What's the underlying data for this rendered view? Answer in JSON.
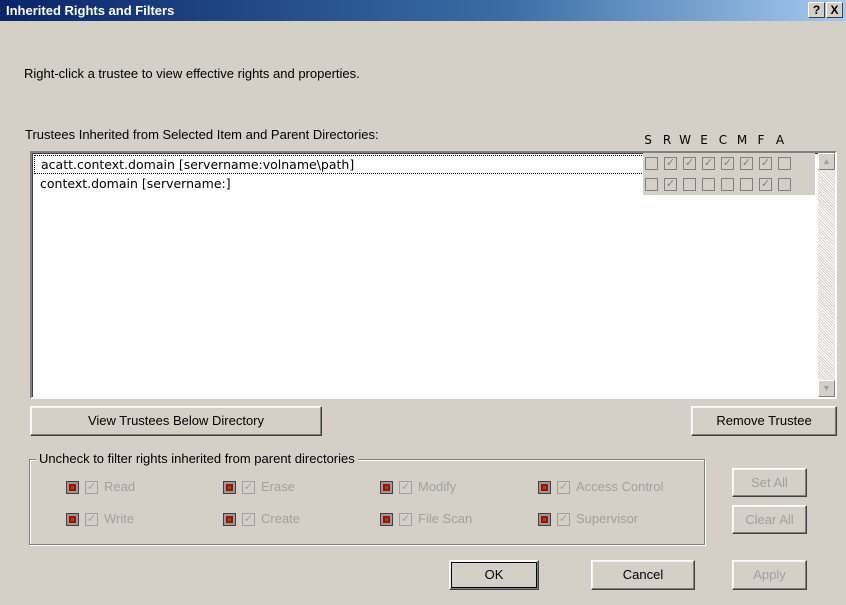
{
  "window": {
    "title": "Inherited Rights and Filters",
    "help_glyph": "?",
    "close_glyph": "X"
  },
  "instruction": "Right-click a trustee to view effective rights and properties.",
  "trustees_label": "Trustees Inherited from Selected Item and Parent Directories:",
  "rights_columns": [
    "S",
    "R",
    "W",
    "E",
    "C",
    "M",
    "F",
    "A"
  ],
  "trustees": [
    {
      "name": "acatt.context.domain [servername:volname\\path]",
      "rights": [
        false,
        true,
        true,
        true,
        true,
        true,
        true,
        false
      ]
    },
    {
      "name": "context.domain [servername:]",
      "rights": [
        false,
        true,
        false,
        false,
        false,
        false,
        true,
        false
      ]
    }
  ],
  "buttons": {
    "view_trustees": "View Trustees Below Directory",
    "remove_trustee": "Remove Trustee",
    "set_all": "Set All",
    "clear_all": "Clear All",
    "ok": "OK",
    "cancel": "Cancel",
    "apply": "Apply"
  },
  "filter_group": {
    "legend": "Uncheck to filter rights inherited from parent directories",
    "items": [
      {
        "label": "Read",
        "checked": true
      },
      {
        "label": "Erase",
        "checked": true
      },
      {
        "label": "Modify",
        "checked": true
      },
      {
        "label": "Access Control",
        "checked": true
      },
      {
        "label": "Write",
        "checked": true
      },
      {
        "label": "Create",
        "checked": true
      },
      {
        "label": "File Scan",
        "checked": true
      },
      {
        "label": "Supervisor",
        "checked": true
      }
    ]
  },
  "scroll_glyphs": {
    "up": "▲",
    "down": "▼"
  },
  "check_glyph": "✓",
  "colors": {
    "title_start": "#0a246a",
    "title_end": "#a6caf0",
    "face": "#d4d0c8",
    "filter_icon": "#c00000"
  }
}
